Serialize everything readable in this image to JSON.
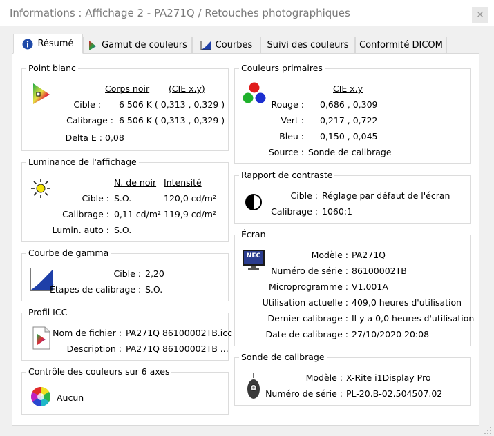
{
  "window": {
    "title": "Informations : Affichage 2 - PA271Q / Retouches photographiques",
    "close_symbol": "✕"
  },
  "tabs": [
    {
      "label": "Résumé",
      "icon": "info-icon"
    },
    {
      "label": "Gamut de couleurs",
      "icon": "gamut-icon"
    },
    {
      "label": "Courbes",
      "icon": "curve-icon"
    },
    {
      "label": "Suivi des couleurs",
      "icon": ""
    },
    {
      "label": "Conformité DICOM",
      "icon": ""
    }
  ],
  "white_point": {
    "title": "Point blanc",
    "col1_header": "Corps noir",
    "col2_header": "(CIE x,y)",
    "target_label": "Cible :",
    "target_value": "6 506 K ( 0,313 , 0,329 )",
    "calibration_label": "Calibrage :",
    "calibration_value": "6 506 K ( 0,313 , 0,329 )",
    "delta_label": "Delta E :",
    "delta_value": "0,08"
  },
  "luminance": {
    "title": "Luminance de l'affichage",
    "col1_header": "N. de noir",
    "col2_header": "Intensité",
    "target_label": "Cible :",
    "target_black": "S.O.",
    "target_intensity": "120,0 cd/m²",
    "calibration_label": "Calibrage :",
    "calibration_black": "0,11 cd/m²",
    "calibration_intensity": "119,9 cd/m²",
    "auto_label": "Lumin. auto :",
    "auto_value": "S.O."
  },
  "gamma": {
    "title": "Courbe de gamma",
    "target_label": "Cible :",
    "target_value": "2,20",
    "steps_label": "Étapes de calibrage :",
    "steps_value": "S.O."
  },
  "icc": {
    "title": "Profil ICC",
    "filename_label": "Nom de fichier :",
    "filename_value": "PA271Q 86100002TB.icc",
    "description_label": "Description :",
    "description_value": "PA271Q 86100002TB ..."
  },
  "six_axis": {
    "title": "Contrôle des couleurs sur 6 axes",
    "value": "Aucun"
  },
  "primaries": {
    "title": "Couleurs primaires",
    "header": "CIE x,y",
    "red_label": "Rouge :",
    "red_value": "0,686 , 0,309",
    "green_label": "Vert :",
    "green_value": "0,217 , 0,722",
    "blue_label": "Bleu :",
    "blue_value": "0,150 , 0,045",
    "source_label": "Source :",
    "source_value": "Sonde de calibrage"
  },
  "contrast": {
    "title": "Rapport de contraste",
    "target_label": "Cible :",
    "target_value": "Réglage par défaut de l'écran",
    "calibration_label": "Calibrage :",
    "calibration_value": "1060:1"
  },
  "screen": {
    "title": "Écran",
    "monitor_logo": "NEC",
    "model_label": "Modèle :",
    "model_value": "PA271Q",
    "serial_label": "Numéro de série :",
    "serial_value": "86100002TB",
    "firmware_label": "Microprogramme :",
    "firmware_value": "V1.001A",
    "usage_label": "Utilisation actuelle :",
    "usage_value": "409,0 heures d'utilisation",
    "last_cal_label": "Dernier calibrage :",
    "last_cal_value": "Il y a 0,0 heures d'utilisation",
    "cal_date_label": "Date de calibrage :",
    "cal_date_value": "27/10/2020 20:08"
  },
  "probe": {
    "title": "Sonde de calibrage",
    "model_label": "Modèle :",
    "model_value": "X-Rite i1Display Pro",
    "serial_label": "Numéro de série :",
    "serial_value": "PL-20.B-02.504507.02"
  },
  "colors": {
    "accent_blue": "#1e3fa8",
    "border": "#dcdcdc",
    "title_gray": "#7a7a7a"
  }
}
